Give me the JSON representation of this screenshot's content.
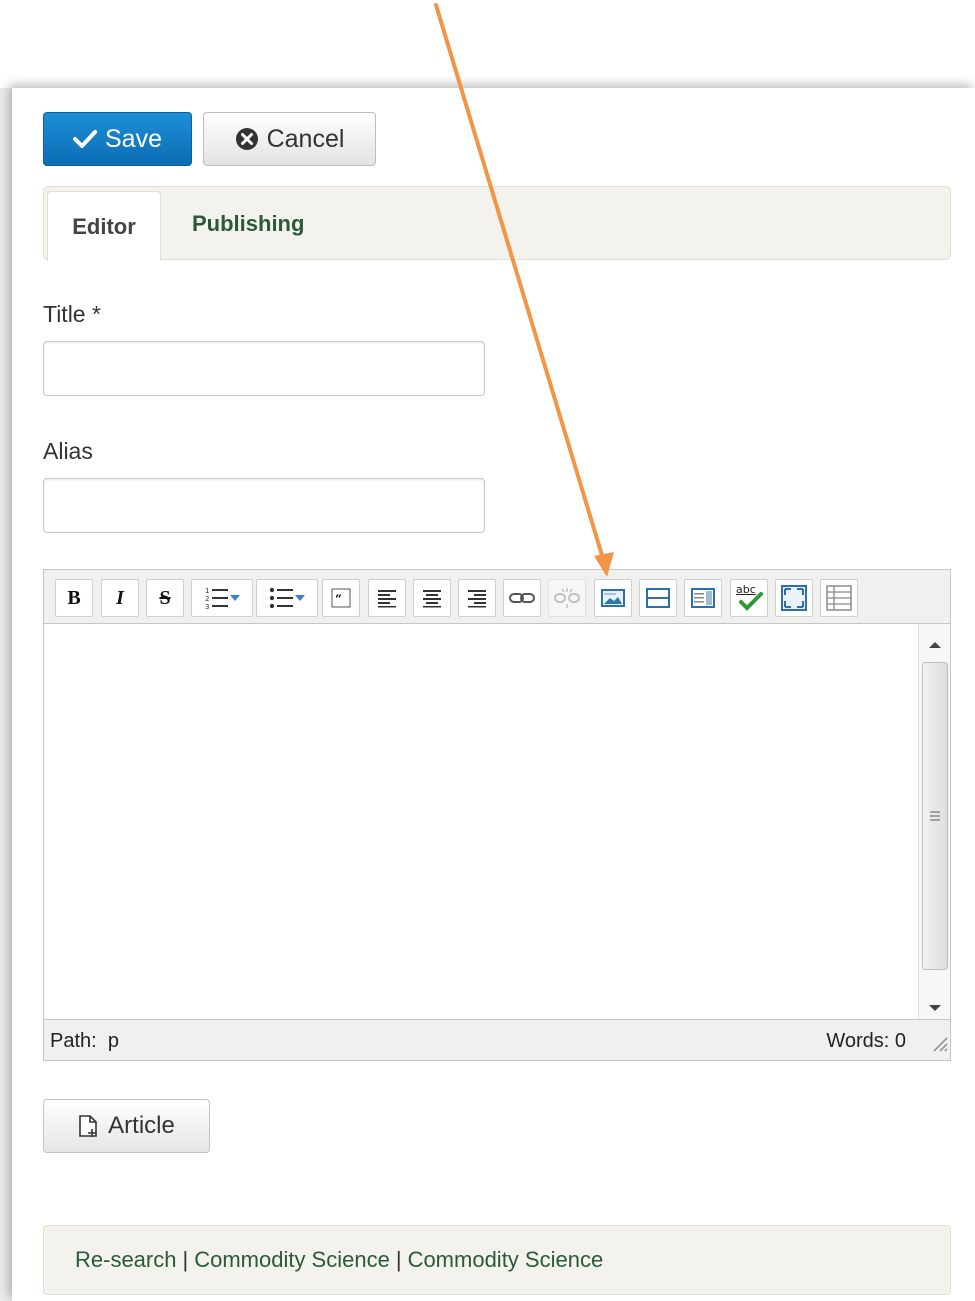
{
  "toolbar": {
    "save_label": "Save",
    "cancel_label": "Cancel"
  },
  "tabs": [
    {
      "label": "Editor",
      "active": true
    },
    {
      "label": "Publishing",
      "active": false
    }
  ],
  "form": {
    "title_label": "Title *",
    "title_value": "",
    "alias_label": "Alias",
    "alias_value": ""
  },
  "editor": {
    "buttons": [
      "bold-icon",
      "italic-icon",
      "strikethrough-icon",
      "ordered-list-icon",
      "unordered-list-icon",
      "blockquote-icon",
      "align-left-icon",
      "align-center-icon",
      "align-right-icon",
      "link-icon",
      "unlink-icon",
      "image-icon",
      "horizontal-rule-icon",
      "template-icon",
      "spellcheck-icon",
      "fullscreen-icon",
      "table-icon"
    ],
    "bold_glyph": "B",
    "italic_glyph": "I",
    "strike_glyph": "S",
    "spell_glyph": "abc",
    "path_label": "Path:",
    "path_value": "p",
    "words_label": "Words: 0"
  },
  "article_button_label": "Article",
  "footer": {
    "links": [
      "Re-search",
      "Commodity Science",
      "Commodity Science"
    ],
    "separator": "|"
  },
  "colors": {
    "save_button": "#1581cf",
    "annotation_arrow": "#f29546",
    "tab_bar": "#f4f2ec",
    "link_text": "#2a5a3a"
  }
}
